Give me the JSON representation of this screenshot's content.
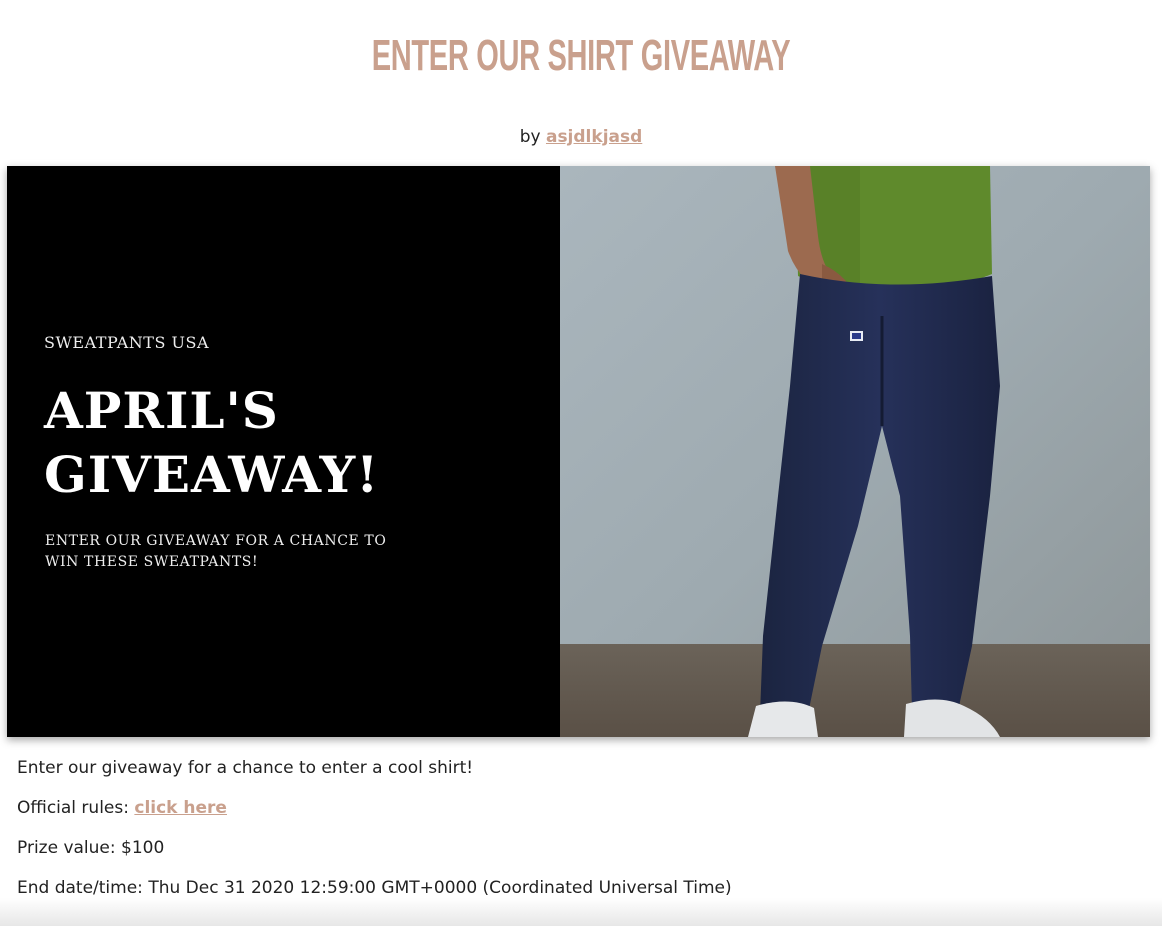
{
  "page": {
    "title": "Enter our shirt giveaway",
    "by_prefix": "by",
    "author": "asjdlkjasd"
  },
  "banner": {
    "brand": "SWEATPANTS USA",
    "headline_line1": "APRIL'S",
    "headline_line2": "GIVEAWAY!",
    "subline": "Enter our giveaway for a chance to win these sweatpants!",
    "photo_icon": "man-in-sweatpants-photo"
  },
  "details": {
    "description": "Enter our giveaway for a chance to enter a cool shirt!",
    "rules_label": "Official rules:",
    "rules_link": "click here",
    "prize_label": "Prize value:",
    "prize_value": "$100",
    "end_label": "End date/time:",
    "end_value": "Thu Dec 31 2020 12:59:00 GMT+0000 (Coordinated Universal Time)"
  },
  "colors": {
    "accent": "#c9a08d",
    "text": "#222222",
    "banner_bg": "#000000"
  }
}
